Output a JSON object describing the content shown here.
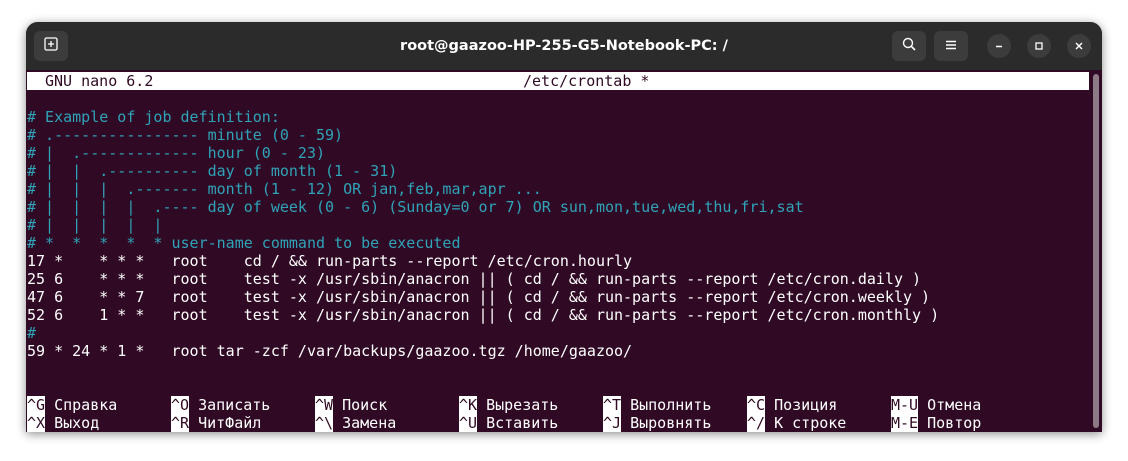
{
  "window": {
    "title": "root@gaazoo-HP-255-G5-Notebook-PC: /"
  },
  "icons": {
    "new_tab": "new-tab-icon",
    "search": "search-icon",
    "menu": "hamburger-menu-icon",
    "minimize": "minimize-icon",
    "maximize": "maximize-icon",
    "close": "close-icon"
  },
  "colors": {
    "terminal_bg": "#300a24",
    "comment": "#2fa3b8",
    "titlebar": "#2b2b2b"
  },
  "nano": {
    "version": "GNU nano 6.2",
    "filename": "/etc/crontab *"
  },
  "lines": [
    {
      "text": "# Example of job definition:",
      "type": "comment"
    },
    {
      "text": "# .---------------- minute (0 - 59)",
      "type": "comment"
    },
    {
      "text": "# |  .------------- hour (0 - 23)",
      "type": "comment"
    },
    {
      "text": "# |  |  .---------- day of month (1 - 31)",
      "type": "comment"
    },
    {
      "text": "# |  |  |  .------- month (1 - 12) OR jan,feb,mar,apr ...",
      "type": "comment"
    },
    {
      "text": "# |  |  |  |  .---- day of week (0 - 6) (Sunday=0 or 7) OR sun,mon,tue,wed,thu,fri,sat",
      "type": "comment"
    },
    {
      "text": "# |  |  |  |  |",
      "type": "comment"
    },
    {
      "text": "# *  *  *  *  * user-name command to be executed",
      "type": "comment"
    },
    {
      "text": "17 *    * * *   root    cd / && run-parts --report /etc/cron.hourly",
      "type": "code"
    },
    {
      "text": "25 6    * * *   root    test -x /usr/sbin/anacron || ( cd / && run-parts --report /etc/cron.daily )",
      "type": "code"
    },
    {
      "text": "47 6    * * 7   root    test -x /usr/sbin/anacron || ( cd / && run-parts --report /etc/cron.weekly )",
      "type": "code"
    },
    {
      "text": "52 6    1 * *   root    test -x /usr/sbin/anacron || ( cd / && run-parts --report /etc/cron.monthly )",
      "type": "code"
    },
    {
      "text": "#",
      "type": "comment"
    },
    {
      "text": "59 * 24 * 1 *   root tar -zcf /var/backups/gaazoo.tgz /home/gaazoo/",
      "type": "code"
    }
  ],
  "shortcuts_row1": [
    {
      "key": "^G",
      "label": "Справка"
    },
    {
      "key": "^O",
      "label": "Записать"
    },
    {
      "key": "^W",
      "label": "Поиск"
    },
    {
      "key": "^K",
      "label": "Вырезать"
    },
    {
      "key": "^T",
      "label": "Выполнить"
    },
    {
      "key": "^C",
      "label": "Позиция"
    },
    {
      "key": "M-U",
      "label": "Отмена"
    }
  ],
  "shortcuts_row2": [
    {
      "key": "^X",
      "label": "Выход"
    },
    {
      "key": "^R",
      "label": "ЧитФайл"
    },
    {
      "key": "^\\",
      "label": "Замена"
    },
    {
      "key": "^U",
      "label": "Вставить"
    },
    {
      "key": "^J",
      "label": "Выровнять"
    },
    {
      "key": "^/",
      "label": "К строке"
    },
    {
      "key": "M-E",
      "label": "Повтор"
    }
  ]
}
